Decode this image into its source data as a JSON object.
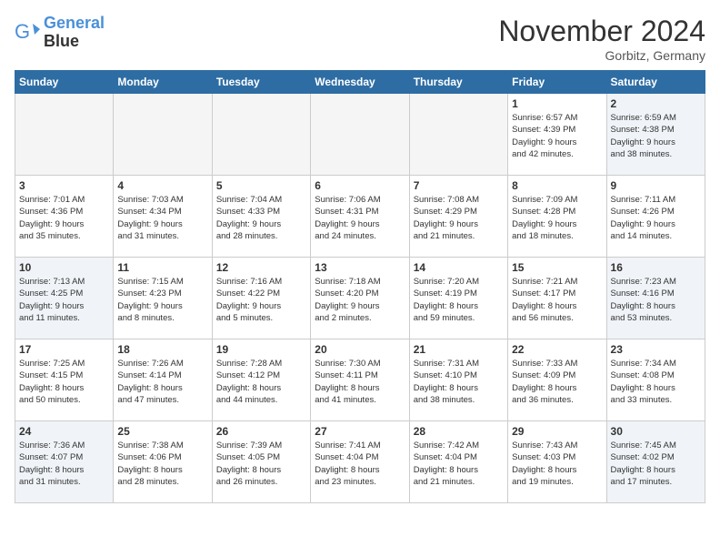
{
  "header": {
    "logo_line1": "General",
    "logo_line2": "Blue",
    "month": "November 2024",
    "location": "Gorbitz, Germany"
  },
  "weekdays": [
    "Sunday",
    "Monday",
    "Tuesday",
    "Wednesday",
    "Thursday",
    "Friday",
    "Saturday"
  ],
  "weeks": [
    [
      {
        "day": "",
        "info": ""
      },
      {
        "day": "",
        "info": ""
      },
      {
        "day": "",
        "info": ""
      },
      {
        "day": "",
        "info": ""
      },
      {
        "day": "",
        "info": ""
      },
      {
        "day": "1",
        "info": "Sunrise: 6:57 AM\nSunset: 4:39 PM\nDaylight: 9 hours\nand 42 minutes."
      },
      {
        "day": "2",
        "info": "Sunrise: 6:59 AM\nSunset: 4:38 PM\nDaylight: 9 hours\nand 38 minutes."
      }
    ],
    [
      {
        "day": "3",
        "info": "Sunrise: 7:01 AM\nSunset: 4:36 PM\nDaylight: 9 hours\nand 35 minutes."
      },
      {
        "day": "4",
        "info": "Sunrise: 7:03 AM\nSunset: 4:34 PM\nDaylight: 9 hours\nand 31 minutes."
      },
      {
        "day": "5",
        "info": "Sunrise: 7:04 AM\nSunset: 4:33 PM\nDaylight: 9 hours\nand 28 minutes."
      },
      {
        "day": "6",
        "info": "Sunrise: 7:06 AM\nSunset: 4:31 PM\nDaylight: 9 hours\nand 24 minutes."
      },
      {
        "day": "7",
        "info": "Sunrise: 7:08 AM\nSunset: 4:29 PM\nDaylight: 9 hours\nand 21 minutes."
      },
      {
        "day": "8",
        "info": "Sunrise: 7:09 AM\nSunset: 4:28 PM\nDaylight: 9 hours\nand 18 minutes."
      },
      {
        "day": "9",
        "info": "Sunrise: 7:11 AM\nSunset: 4:26 PM\nDaylight: 9 hours\nand 14 minutes."
      }
    ],
    [
      {
        "day": "10",
        "info": "Sunrise: 7:13 AM\nSunset: 4:25 PM\nDaylight: 9 hours\nand 11 minutes."
      },
      {
        "day": "11",
        "info": "Sunrise: 7:15 AM\nSunset: 4:23 PM\nDaylight: 9 hours\nand 8 minutes."
      },
      {
        "day": "12",
        "info": "Sunrise: 7:16 AM\nSunset: 4:22 PM\nDaylight: 9 hours\nand 5 minutes."
      },
      {
        "day": "13",
        "info": "Sunrise: 7:18 AM\nSunset: 4:20 PM\nDaylight: 9 hours\nand 2 minutes."
      },
      {
        "day": "14",
        "info": "Sunrise: 7:20 AM\nSunset: 4:19 PM\nDaylight: 8 hours\nand 59 minutes."
      },
      {
        "day": "15",
        "info": "Sunrise: 7:21 AM\nSunset: 4:17 PM\nDaylight: 8 hours\nand 56 minutes."
      },
      {
        "day": "16",
        "info": "Sunrise: 7:23 AM\nSunset: 4:16 PM\nDaylight: 8 hours\nand 53 minutes."
      }
    ],
    [
      {
        "day": "17",
        "info": "Sunrise: 7:25 AM\nSunset: 4:15 PM\nDaylight: 8 hours\nand 50 minutes."
      },
      {
        "day": "18",
        "info": "Sunrise: 7:26 AM\nSunset: 4:14 PM\nDaylight: 8 hours\nand 47 minutes."
      },
      {
        "day": "19",
        "info": "Sunrise: 7:28 AM\nSunset: 4:12 PM\nDaylight: 8 hours\nand 44 minutes."
      },
      {
        "day": "20",
        "info": "Sunrise: 7:30 AM\nSunset: 4:11 PM\nDaylight: 8 hours\nand 41 minutes."
      },
      {
        "day": "21",
        "info": "Sunrise: 7:31 AM\nSunset: 4:10 PM\nDaylight: 8 hours\nand 38 minutes."
      },
      {
        "day": "22",
        "info": "Sunrise: 7:33 AM\nSunset: 4:09 PM\nDaylight: 8 hours\nand 36 minutes."
      },
      {
        "day": "23",
        "info": "Sunrise: 7:34 AM\nSunset: 4:08 PM\nDaylight: 8 hours\nand 33 minutes."
      }
    ],
    [
      {
        "day": "24",
        "info": "Sunrise: 7:36 AM\nSunset: 4:07 PM\nDaylight: 8 hours\nand 31 minutes."
      },
      {
        "day": "25",
        "info": "Sunrise: 7:38 AM\nSunset: 4:06 PM\nDaylight: 8 hours\nand 28 minutes."
      },
      {
        "day": "26",
        "info": "Sunrise: 7:39 AM\nSunset: 4:05 PM\nDaylight: 8 hours\nand 26 minutes."
      },
      {
        "day": "27",
        "info": "Sunrise: 7:41 AM\nSunset: 4:04 PM\nDaylight: 8 hours\nand 23 minutes."
      },
      {
        "day": "28",
        "info": "Sunrise: 7:42 AM\nSunset: 4:04 PM\nDaylight: 8 hours\nand 21 minutes."
      },
      {
        "day": "29",
        "info": "Sunrise: 7:43 AM\nSunset: 4:03 PM\nDaylight: 8 hours\nand 19 minutes."
      },
      {
        "day": "30",
        "info": "Sunrise: 7:45 AM\nSunset: 4:02 PM\nDaylight: 8 hours\nand 17 minutes."
      }
    ]
  ]
}
